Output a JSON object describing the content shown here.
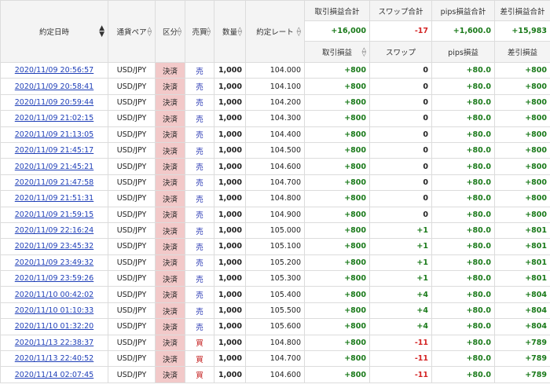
{
  "columns": {
    "date": "約定日時",
    "pair": "通貨ペア",
    "kubun": "区分",
    "side": "売買",
    "qty": "数量",
    "rate": "約定レート",
    "pl": "取引損益",
    "swap": "スワップ",
    "pips": "pips損益",
    "net": "差引損益"
  },
  "totals": {
    "pl_label": "取引損益合計",
    "swap_label": "スワップ合計",
    "pips_label": "pips損益合計",
    "net_label": "差引損益合計",
    "pl_value": "+16,000",
    "swap_value": "-17",
    "pips_value": "+1,600.0",
    "net_value": "+15,983"
  },
  "sort_icons": {
    "both_up": "▲",
    "both_down": "▼",
    "up_outline": "△",
    "down_outline": "▽"
  },
  "colors": {
    "positive": "#1a7a1a",
    "negative": "#d42424",
    "link": "#1f3fb8",
    "kubun_bg": "#f2c9c9",
    "sell": "#1f2fb0",
    "buy": "#c42020"
  },
  "rows": [
    {
      "date": "2020/11/09 20:56:57",
      "pair": "USD/JPY",
      "kubun": "決済",
      "side": "売",
      "side_type": "sell",
      "qty": "1,000",
      "rate": "104.000",
      "pl": "+800",
      "swap": "0",
      "pips": "+80.0",
      "net": "+800"
    },
    {
      "date": "2020/11/09 20:58:41",
      "pair": "USD/JPY",
      "kubun": "決済",
      "side": "売",
      "side_type": "sell",
      "qty": "1,000",
      "rate": "104.100",
      "pl": "+800",
      "swap": "0",
      "pips": "+80.0",
      "net": "+800"
    },
    {
      "date": "2020/11/09 20:59:44",
      "pair": "USD/JPY",
      "kubun": "決済",
      "side": "売",
      "side_type": "sell",
      "qty": "1,000",
      "rate": "104.200",
      "pl": "+800",
      "swap": "0",
      "pips": "+80.0",
      "net": "+800"
    },
    {
      "date": "2020/11/09 21:02:15",
      "pair": "USD/JPY",
      "kubun": "決済",
      "side": "売",
      "side_type": "sell",
      "qty": "1,000",
      "rate": "104.300",
      "pl": "+800",
      "swap": "0",
      "pips": "+80.0",
      "net": "+800"
    },
    {
      "date": "2020/11/09 21:13:05",
      "pair": "USD/JPY",
      "kubun": "決済",
      "side": "売",
      "side_type": "sell",
      "qty": "1,000",
      "rate": "104.400",
      "pl": "+800",
      "swap": "0",
      "pips": "+80.0",
      "net": "+800"
    },
    {
      "date": "2020/11/09 21:45:17",
      "pair": "USD/JPY",
      "kubun": "決済",
      "side": "売",
      "side_type": "sell",
      "qty": "1,000",
      "rate": "104.500",
      "pl": "+800",
      "swap": "0",
      "pips": "+80.0",
      "net": "+800"
    },
    {
      "date": "2020/11/09 21:45:21",
      "pair": "USD/JPY",
      "kubun": "決済",
      "side": "売",
      "side_type": "sell",
      "qty": "1,000",
      "rate": "104.600",
      "pl": "+800",
      "swap": "0",
      "pips": "+80.0",
      "net": "+800"
    },
    {
      "date": "2020/11/09 21:47:58",
      "pair": "USD/JPY",
      "kubun": "決済",
      "side": "売",
      "side_type": "sell",
      "qty": "1,000",
      "rate": "104.700",
      "pl": "+800",
      "swap": "0",
      "pips": "+80.0",
      "net": "+800"
    },
    {
      "date": "2020/11/09 21:51:31",
      "pair": "USD/JPY",
      "kubun": "決済",
      "side": "売",
      "side_type": "sell",
      "qty": "1,000",
      "rate": "104.800",
      "pl": "+800",
      "swap": "0",
      "pips": "+80.0",
      "net": "+800"
    },
    {
      "date": "2020/11/09 21:59:15",
      "pair": "USD/JPY",
      "kubun": "決済",
      "side": "売",
      "side_type": "sell",
      "qty": "1,000",
      "rate": "104.900",
      "pl": "+800",
      "swap": "0",
      "pips": "+80.0",
      "net": "+800"
    },
    {
      "date": "2020/11/09 22:16:24",
      "pair": "USD/JPY",
      "kubun": "決済",
      "side": "売",
      "side_type": "sell",
      "qty": "1,000",
      "rate": "105.000",
      "pl": "+800",
      "swap": "+1",
      "pips": "+80.0",
      "net": "+801"
    },
    {
      "date": "2020/11/09 23:45:32",
      "pair": "USD/JPY",
      "kubun": "決済",
      "side": "売",
      "side_type": "sell",
      "qty": "1,000",
      "rate": "105.100",
      "pl": "+800",
      "swap": "+1",
      "pips": "+80.0",
      "net": "+801"
    },
    {
      "date": "2020/11/09 23:49:32",
      "pair": "USD/JPY",
      "kubun": "決済",
      "side": "売",
      "side_type": "sell",
      "qty": "1,000",
      "rate": "105.200",
      "pl": "+800",
      "swap": "+1",
      "pips": "+80.0",
      "net": "+801"
    },
    {
      "date": "2020/11/09 23:59:26",
      "pair": "USD/JPY",
      "kubun": "決済",
      "side": "売",
      "side_type": "sell",
      "qty": "1,000",
      "rate": "105.300",
      "pl": "+800",
      "swap": "+1",
      "pips": "+80.0",
      "net": "+801"
    },
    {
      "date": "2020/11/10 00:42:02",
      "pair": "USD/JPY",
      "kubun": "決済",
      "side": "売",
      "side_type": "sell",
      "qty": "1,000",
      "rate": "105.400",
      "pl": "+800",
      "swap": "+4",
      "pips": "+80.0",
      "net": "+804"
    },
    {
      "date": "2020/11/10 01:10:33",
      "pair": "USD/JPY",
      "kubun": "決済",
      "side": "売",
      "side_type": "sell",
      "qty": "1,000",
      "rate": "105.500",
      "pl": "+800",
      "swap": "+4",
      "pips": "+80.0",
      "net": "+804"
    },
    {
      "date": "2020/11/10 01:32:20",
      "pair": "USD/JPY",
      "kubun": "決済",
      "side": "売",
      "side_type": "sell",
      "qty": "1,000",
      "rate": "105.600",
      "pl": "+800",
      "swap": "+4",
      "pips": "+80.0",
      "net": "+804"
    },
    {
      "date": "2020/11/13 22:38:37",
      "pair": "USD/JPY",
      "kubun": "決済",
      "side": "買",
      "side_type": "buy",
      "qty": "1,000",
      "rate": "104.800",
      "pl": "+800",
      "swap": "-11",
      "pips": "+80.0",
      "net": "+789"
    },
    {
      "date": "2020/11/13 22:40:52",
      "pair": "USD/JPY",
      "kubun": "決済",
      "side": "買",
      "side_type": "buy",
      "qty": "1,000",
      "rate": "104.700",
      "pl": "+800",
      "swap": "-11",
      "pips": "+80.0",
      "net": "+789"
    },
    {
      "date": "2020/11/14 02:07:45",
      "pair": "USD/JPY",
      "kubun": "決済",
      "side": "買",
      "side_type": "buy",
      "qty": "1,000",
      "rate": "104.600",
      "pl": "+800",
      "swap": "-11",
      "pips": "+80.0",
      "net": "+789"
    }
  ]
}
